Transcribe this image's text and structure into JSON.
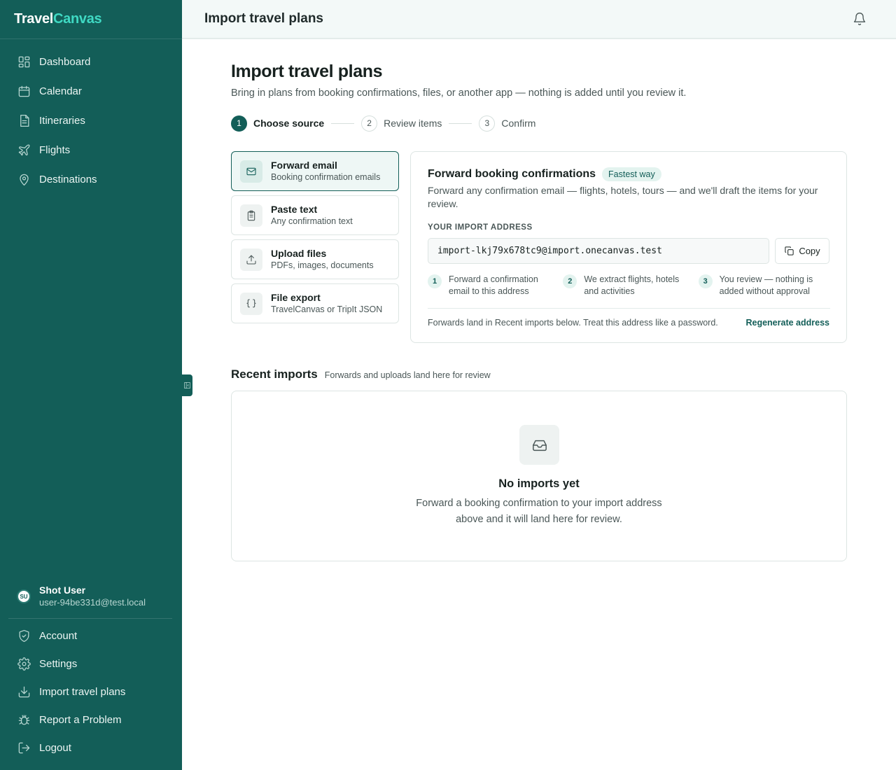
{
  "brand": {
    "part1": "Travel",
    "part2": "Canvas"
  },
  "sidebar": {
    "items": [
      {
        "label": "Dashboard",
        "icon": "dashboard-icon"
      },
      {
        "label": "Calendar",
        "icon": "calendar-icon"
      },
      {
        "label": "Itineraries",
        "icon": "document-icon"
      },
      {
        "label": "Flights",
        "icon": "plane-icon"
      },
      {
        "label": "Destinations",
        "icon": "map-pin-icon"
      }
    ],
    "user": {
      "initials": "SU",
      "name": "Shot User",
      "email": "user-94be331d@test.local"
    },
    "bottom_items": [
      {
        "label": "Account",
        "icon": "shield-icon"
      },
      {
        "label": "Settings",
        "icon": "gear-icon"
      },
      {
        "label": "Import travel plans",
        "icon": "import-icon"
      },
      {
        "label": "Report a Problem",
        "icon": "bug-icon"
      },
      {
        "label": "Logout",
        "icon": "logout-icon"
      }
    ]
  },
  "topbar": {
    "title": "Import travel plans"
  },
  "page": {
    "title": "Import travel plans",
    "subtitle": "Bring in plans from booking confirmations, files, or another app — nothing is added until you review it."
  },
  "steps": [
    {
      "num": "1",
      "label": "Choose source",
      "active": true
    },
    {
      "num": "2",
      "label": "Review items",
      "active": false
    },
    {
      "num": "3",
      "label": "Confirm",
      "active": false
    }
  ],
  "sources": [
    {
      "title": "Forward email",
      "sub": "Booking confirmation emails",
      "icon": "mail-icon",
      "active": true
    },
    {
      "title": "Paste text",
      "sub": "Any confirmation text",
      "icon": "clipboard-icon",
      "active": false
    },
    {
      "title": "Upload files",
      "sub": "PDFs, images, documents",
      "icon": "upload-icon",
      "active": false
    },
    {
      "title": "File export",
      "sub": "TravelCanvas or TripIt JSON",
      "icon": "braces-icon",
      "active": false
    }
  ],
  "panel": {
    "title": "Forward booking confirmations",
    "badge": "Fastest way",
    "description": "Forward any confirmation email — flights, hotels, tours — and we'll draft the items for your review.",
    "address_label": "YOUR IMPORT ADDRESS",
    "address": "import-lkj79x678tc9@import.onecanvas.test",
    "copy_label": "Copy",
    "howto": [
      {
        "num": "1",
        "text": "Forward a confirmation email to this address"
      },
      {
        "num": "2",
        "text": "We extract flights, hotels and activities"
      },
      {
        "num": "3",
        "text": "You review — nothing is added without approval"
      }
    ],
    "footer": "Forwards land in Recent imports below. Treat this address like a password.",
    "regenerate": "Regenerate address"
  },
  "recent": {
    "title": "Recent imports",
    "subtitle": "Forwards and uploads land here for review",
    "empty_title": "No imports yet",
    "empty_text": "Forward a booking confirmation to your import address above and it will land here for review."
  },
  "colors": {
    "sidebar": "#135e58",
    "accent": "#3fd9c3",
    "primary": "#135e58"
  }
}
